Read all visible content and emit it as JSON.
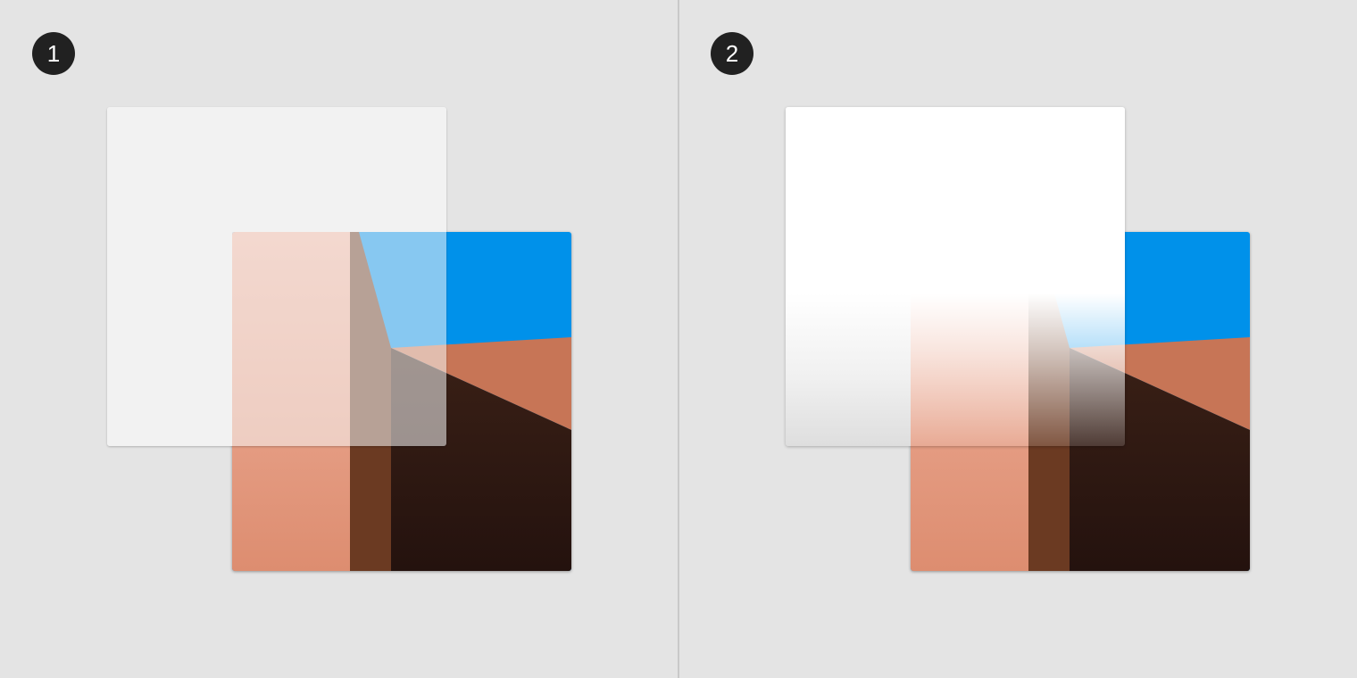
{
  "steps": [
    {
      "number": "1"
    },
    {
      "number": "2"
    }
  ],
  "colors": {
    "background": "#e4e4e4",
    "badge": "#212121",
    "sky": "#0091ea",
    "wall_light": "#e59a7c",
    "wall_shadow": "#2a1610"
  }
}
